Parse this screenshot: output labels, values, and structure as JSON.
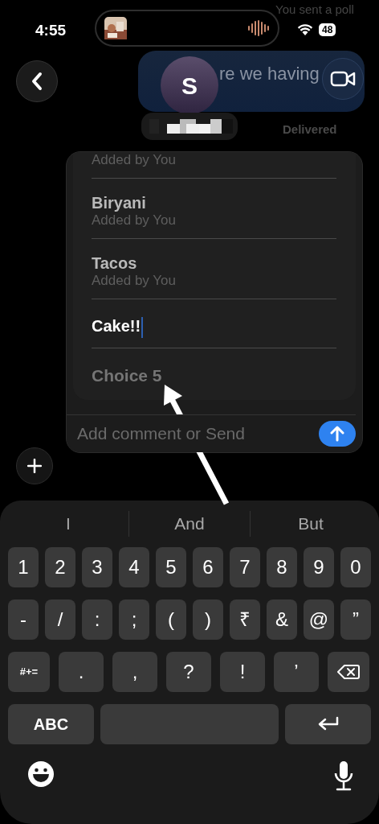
{
  "status_bar": {
    "time": "4:55",
    "notification": "You sent a poll",
    "battery": "48"
  },
  "conversation": {
    "message": "re we having",
    "contact_initial": "S",
    "receipt": "Delivered"
  },
  "poll": {
    "choices": [
      {
        "kind": "added",
        "note": "Added by You"
      },
      {
        "kind": "added",
        "label": "Biryani",
        "note": "Added by You"
      },
      {
        "kind": "added",
        "label": "Tacos",
        "note": "Added by You"
      },
      {
        "kind": "editing",
        "label": "Cake!!"
      },
      {
        "kind": "empty",
        "placeholder": "Choice 5"
      }
    ],
    "comment": {
      "placeholder": "Add comment or Send"
    }
  },
  "keyboard": {
    "suggestions": [
      "I",
      "And",
      "But"
    ],
    "rows": [
      {
        "keys": [
          {
            "kind": "char",
            "label": "1"
          },
          {
            "kind": "char",
            "label": "2"
          },
          {
            "kind": "char",
            "label": "3"
          },
          {
            "kind": "char",
            "label": "4"
          },
          {
            "kind": "char",
            "label": "5"
          },
          {
            "kind": "char",
            "label": "6"
          },
          {
            "kind": "char",
            "label": "7"
          },
          {
            "kind": "char",
            "label": "8"
          },
          {
            "kind": "char",
            "label": "9"
          },
          {
            "kind": "char",
            "label": "0"
          }
        ]
      },
      {
        "keys": [
          {
            "kind": "char",
            "label": "-"
          },
          {
            "kind": "char",
            "label": "/"
          },
          {
            "kind": "char",
            "label": ":"
          },
          {
            "kind": "char",
            "label": ";"
          },
          {
            "kind": "char",
            "label": "("
          },
          {
            "kind": "char",
            "label": ")"
          },
          {
            "kind": "char",
            "label": "₹"
          },
          {
            "kind": "char",
            "label": "&"
          },
          {
            "kind": "char",
            "label": "@"
          },
          {
            "kind": "char",
            "label": "”"
          }
        ]
      },
      {
        "keys": [
          {
            "kind": "mode",
            "label": "#+="
          },
          {
            "kind": "char",
            "label": "."
          },
          {
            "kind": "char",
            "label": ","
          },
          {
            "kind": "char",
            "label": "?"
          },
          {
            "kind": "char",
            "label": "!"
          },
          {
            "kind": "char",
            "label": "’"
          },
          {
            "kind": "backspace"
          }
        ]
      },
      {
        "keys": [
          {
            "kind": "mode",
            "label": "ABC"
          },
          {
            "kind": "space"
          },
          {
            "kind": "return"
          }
        ]
      }
    ]
  }
}
